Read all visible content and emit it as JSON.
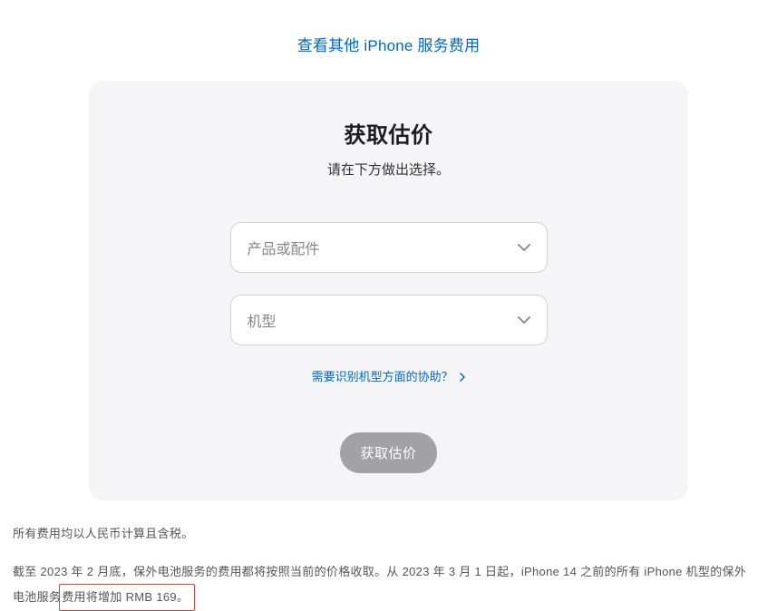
{
  "topLink": {
    "text": "查看其他 iPhone 服务费用"
  },
  "card": {
    "title": "获取估价",
    "subtitle": "请在下方做出选择。",
    "select1": {
      "placeholder": "产品或配件"
    },
    "select2": {
      "placeholder": "机型"
    },
    "helpLink": {
      "text": "需要识别机型方面的协助？"
    },
    "button": {
      "label": "获取估价"
    }
  },
  "footer": {
    "note1": "所有费用均以人民币计算且含税。",
    "note2_part1": "截至 2023 年 2 月底，保外电池服务的费用都将按照当前的价格收取。从 2023 年 3 月 1 日起，iPhone 14 之前的所有 iPhone 机型的保外电池服务",
    "note2_highlight": "费用将增加 RMB 169。"
  }
}
